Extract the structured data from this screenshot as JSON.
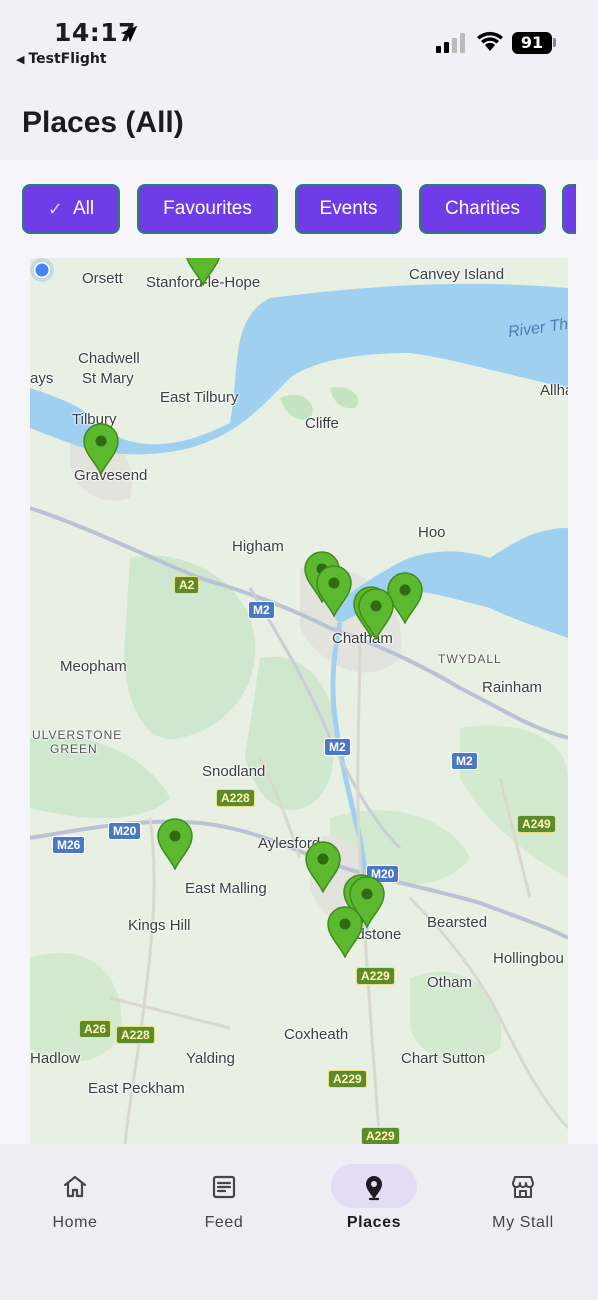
{
  "status_bar": {
    "time": "14:17",
    "back_app": "TestFlight",
    "battery": "91"
  },
  "header": {
    "title": "Places (All)"
  },
  "filters": [
    {
      "label": "All",
      "selected": true
    },
    {
      "label": "Favourites",
      "selected": false
    },
    {
      "label": "Events",
      "selected": false
    },
    {
      "label": "Charities",
      "selected": false
    }
  ],
  "map": {
    "places": [
      {
        "name": "Orsett"
      },
      {
        "name": "Stanford-le-Hope"
      },
      {
        "name": "Canvey Island"
      },
      {
        "name": "River Th"
      },
      {
        "name": "Chadwell"
      },
      {
        "name": "St Mary"
      },
      {
        "name": "ays"
      },
      {
        "name": "East Tilbury"
      },
      {
        "name": "Allha"
      },
      {
        "name": "Tilbury"
      },
      {
        "name": "Cliffe"
      },
      {
        "name": "Gravesend"
      },
      {
        "name": "Hoo"
      },
      {
        "name": "Higham"
      },
      {
        "name": "Chatham"
      },
      {
        "name": "Meopham"
      },
      {
        "name": "TWYDALL"
      },
      {
        "name": "Rainham"
      },
      {
        "name": "ULVERSTONE"
      },
      {
        "name": "GREEN"
      },
      {
        "name": "Snodland"
      },
      {
        "name": "Aylesford"
      },
      {
        "name": "East Malling"
      },
      {
        "name": "Kings Hill"
      },
      {
        "name": "idstone"
      },
      {
        "name": "Bearsted"
      },
      {
        "name": "Hollingbou"
      },
      {
        "name": "Otham"
      },
      {
        "name": "Coxheath"
      },
      {
        "name": "Yalding"
      },
      {
        "name": "Hadlow"
      },
      {
        "name": "East Peckham"
      },
      {
        "name": "Chart Sutton"
      }
    ],
    "roads": [
      {
        "ref": "A2",
        "kind": "a-road"
      },
      {
        "ref": "M2",
        "kind": "motorway"
      },
      {
        "ref": "M2",
        "kind": "motorway"
      },
      {
        "ref": "M2",
        "kind": "motorway"
      },
      {
        "ref": "A228",
        "kind": "a-road"
      },
      {
        "ref": "A249",
        "kind": "a-road"
      },
      {
        "ref": "M26",
        "kind": "motorway"
      },
      {
        "ref": "M20",
        "kind": "motorway"
      },
      {
        "ref": "M20",
        "kind": "motorway"
      },
      {
        "ref": "A229",
        "kind": "a-road"
      },
      {
        "ref": "A26",
        "kind": "a-road"
      },
      {
        "ref": "A228",
        "kind": "a-road"
      },
      {
        "ref": "A229",
        "kind": "a-road"
      },
      {
        "ref": "A229",
        "kind": "a-road"
      }
    ],
    "colors": {
      "land": "#e8efe3",
      "park": "#c8e6c9",
      "water": "#9fd0ef",
      "pin": "#5cb82e",
      "user": "#4285f4"
    }
  },
  "nav": [
    {
      "label": "Home",
      "icon": "home-icon",
      "active": false
    },
    {
      "label": "Feed",
      "icon": "feed-icon",
      "active": false
    },
    {
      "label": "Places",
      "icon": "location-pin-icon",
      "active": true
    },
    {
      "label": "My Stall",
      "icon": "stall-icon",
      "active": false
    }
  ]
}
